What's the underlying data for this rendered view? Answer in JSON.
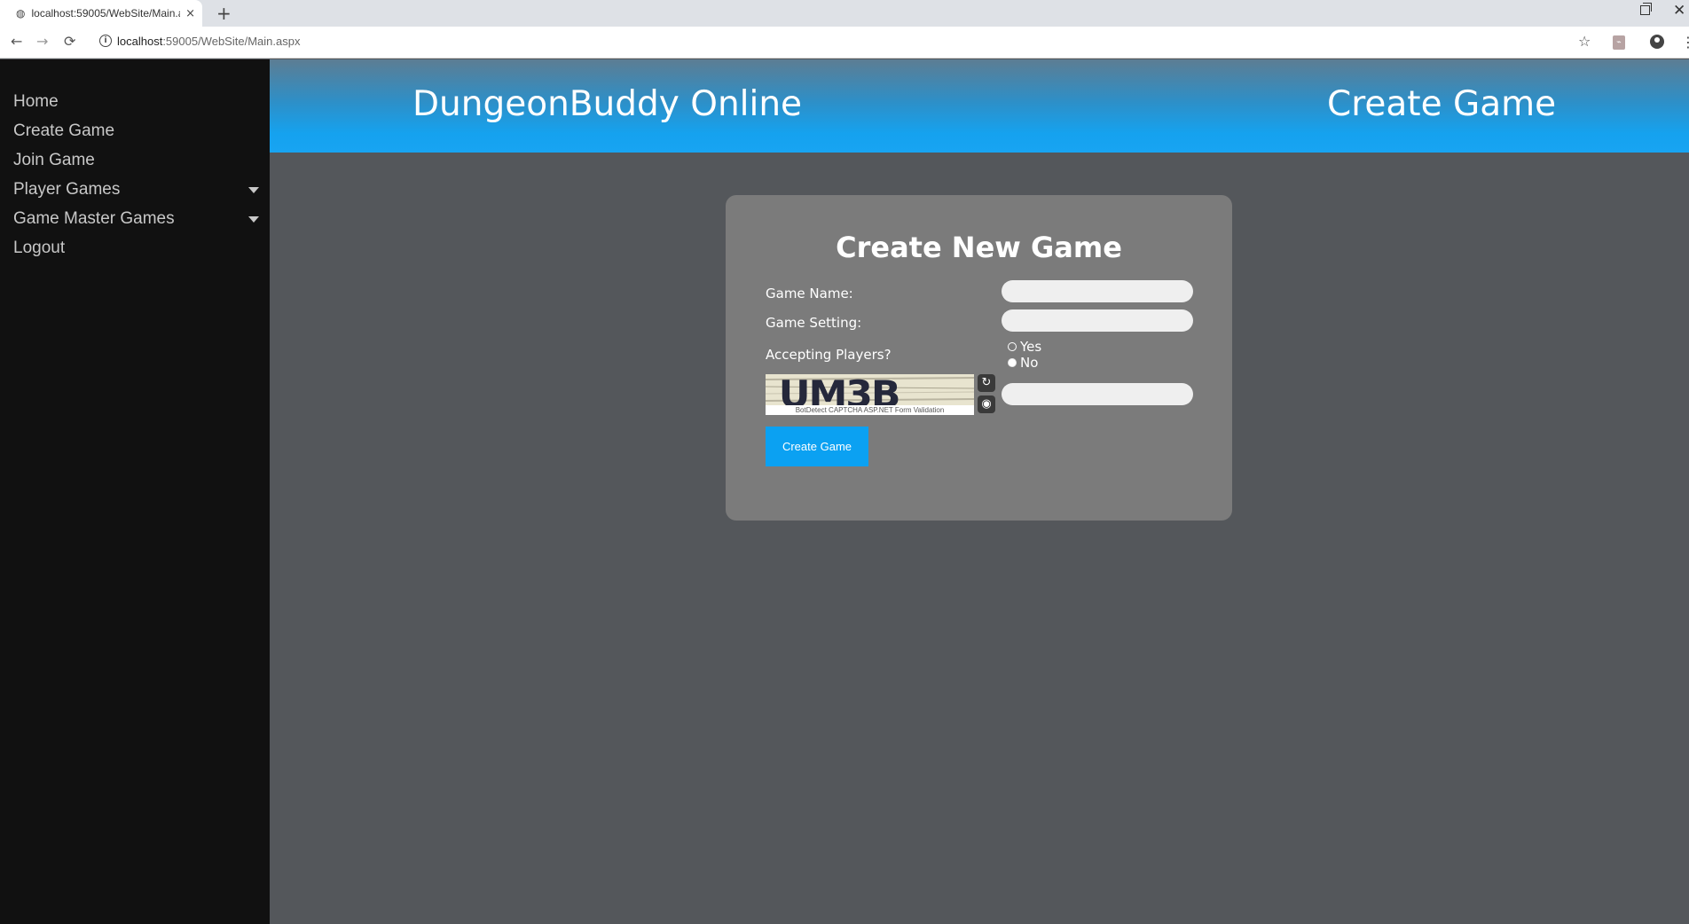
{
  "browser": {
    "tab_title": "localhost:59005/WebSite/Main.a",
    "tab_close": "×",
    "new_tab": "+",
    "url_host": "localhost",
    "url_rest": ":59005/WebSite/Main.aspx",
    "back": "←",
    "forward": "→",
    "reload": "⟳",
    "bookmark": "☆",
    "menu": "⋮",
    "close_window": "✕"
  },
  "sidebar": {
    "items": [
      {
        "label": "Home"
      },
      {
        "label": "Create Game"
      },
      {
        "label": "Join Game"
      },
      {
        "label": "Player Games",
        "dropdown": true
      },
      {
        "label": "Game Master Games",
        "dropdown": true
      },
      {
        "label": "Logout"
      }
    ]
  },
  "header": {
    "site_title": "DungeonBuddy Online",
    "page_heading": "Create Game"
  },
  "form": {
    "title": "Create New Game",
    "game_name_label": "Game Name:",
    "game_name_value": "",
    "game_setting_label": "Game Setting:",
    "game_setting_value": "",
    "accepting_label": "Accepting Players?",
    "radio_yes": "Yes",
    "radio_no": "No",
    "selected_option": "No",
    "captcha_text": "UM3B",
    "captcha_footer": "BotDetect CAPTCHA ASP.NET Form Validation",
    "captcha_value": "",
    "submit_label": "Create Game"
  },
  "colors": {
    "banner_accent": "#18a4f2",
    "button": "#0ba1f2",
    "card": "#7b7b7b",
    "page_bg": "#54575b",
    "sidebar_bg": "#111111"
  }
}
